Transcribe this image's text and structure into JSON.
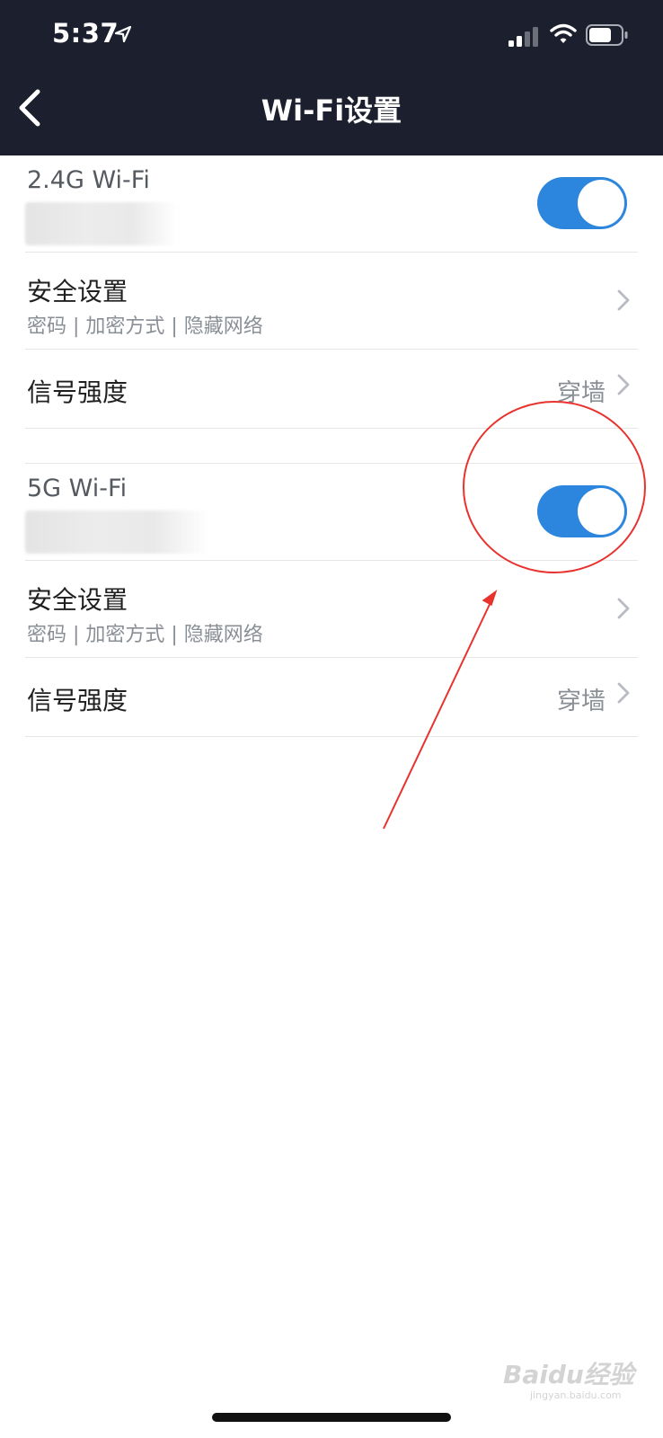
{
  "status_bar": {
    "time": "5:37"
  },
  "header": {
    "title": "Wi-Fi设置",
    "background": "#1c1f2e"
  },
  "wifi_24": {
    "title": "2.4G Wi-Fi",
    "enabled": true,
    "security": {
      "label": "安全设置",
      "sub": "密码 | 加密方式 | 隐藏网络"
    },
    "signal": {
      "label": "信号强度",
      "value": "穿墙"
    }
  },
  "wifi_5": {
    "title": "5G Wi-Fi",
    "enabled": true,
    "security": {
      "label": "安全设置",
      "sub": "密码 | 加密方式 | 隐藏网络"
    },
    "signal": {
      "label": "信号强度",
      "value": "穿墙"
    }
  },
  "colors": {
    "toggle_on": "#2d86de",
    "annotation": "#e8322e"
  },
  "watermark": {
    "brand": "Baidu经验",
    "url": "jingyan.baidu.com"
  }
}
